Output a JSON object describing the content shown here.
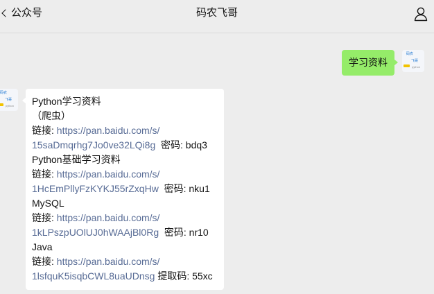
{
  "header": {
    "back_label": "公众号",
    "title": "码农飞哥"
  },
  "messages": {
    "sent_text": "学习资料",
    "received": {
      "title1": "Python学习资料",
      "title1_sub": "（爬虫）",
      "link_label": "链接: ",
      "pwd_label": "密码: ",
      "code_label": "提取码: ",
      "items": [
        {
          "url_line1": "https://pan.baidu.com/s/",
          "url_line2": "15saDmqrhg7Jo0ve32LQi8g",
          "code": "bdq3"
        },
        {
          "name": "Python基础学习资料",
          "url_line1": "https://pan.baidu.com/s/",
          "url_line2": "1HcEmPllyFzKYKJ55rZxqHw",
          "code": "nku1"
        },
        {
          "name": "MySQL",
          "url_line1": "https://pan.baidu.com/s/",
          "url_line2": "1kLPszpUOlUJ0hWAAjBl0Rg",
          "code": "nr10"
        },
        {
          "name": "Java",
          "url_line1": "https://pan.baidu.com/s/",
          "url_line2": "1lsfquK5isqbCWL8uaUDnsg",
          "code": "55xc"
        }
      ]
    }
  },
  "avatar": {
    "line_a": "码农",
    "line_b": "飞哥",
    "line_c": "python"
  },
  "colors": {
    "background": "#ededed",
    "sent_bubble": "#95ec69",
    "received_bubble": "#ffffff",
    "link": "#576b95"
  }
}
